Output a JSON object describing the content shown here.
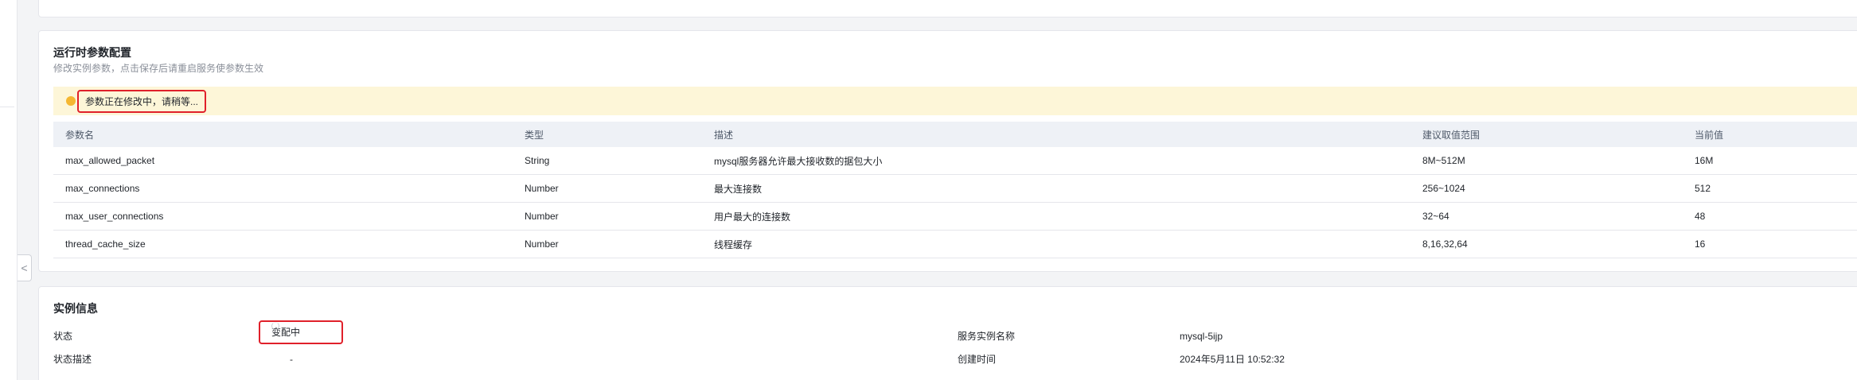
{
  "params_section": {
    "title": "运行时参数配置",
    "description": "修改实例参数，点击保存后请重启服务使参数生效",
    "alert_text": "参数正在修改中，请稍等...",
    "close_glyph": "×",
    "columns": [
      "参数名",
      "类型",
      "描述",
      "建议取值范围",
      "当前值"
    ],
    "rows": [
      [
        "max_allowed_packet",
        "String",
        "mysql服务器允许最大接收数的据包大小",
        "8M~512M",
        "16M"
      ],
      [
        "max_connections",
        "Number",
        "最大连接数",
        "256~1024",
        "512"
      ],
      [
        "max_user_connections",
        "Number",
        "用户最大的连接数",
        "32~64",
        "48"
      ],
      [
        "thread_cache_size",
        "Number",
        "线程缓存",
        "8,16,32,64",
        "16"
      ]
    ]
  },
  "instance_info": {
    "title": "实例信息",
    "status_label": "状态",
    "status_value": "变配中",
    "status_desc_label": "状态描述",
    "status_desc_value": "-",
    "service_name_label": "服务实例名称",
    "service_name_value": "mysql-5ijp",
    "created_label": "创建时间",
    "created_value": "2024年5月11日 10:52:32"
  },
  "collapse_glyph": "<",
  "colors": {
    "warning": "#f5b731",
    "alert_bg": "#fdf6d8",
    "highlight": "#e0202a",
    "header_bg": "#eef1f6"
  }
}
